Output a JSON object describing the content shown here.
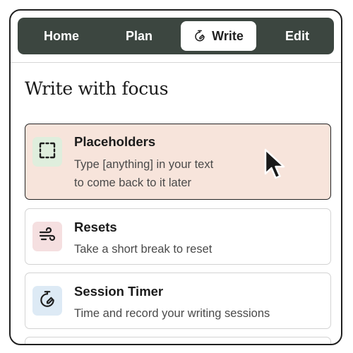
{
  "nav": {
    "tabs": [
      {
        "label": "Home"
      },
      {
        "label": "Plan"
      },
      {
        "label": "Write",
        "icon": "timer-pen-icon",
        "active": true
      },
      {
        "label": "Edit"
      }
    ]
  },
  "page": {
    "title": "Write with focus"
  },
  "cards": [
    {
      "title": "Placeholders",
      "desc_line1": "Type [anything] in your text",
      "desc_line2": "to come back to it later",
      "icon": "placeholder-dashed-box-icon",
      "badge_color": "#dfeedd",
      "active": true
    },
    {
      "title": "Resets",
      "desc": "Take a short break to reset",
      "icon": "wind-icon",
      "badge_color": "#f5dfe0"
    },
    {
      "title": "Session Timer",
      "desc": "Time and record your writing sessions",
      "icon": "timer-pen-icon",
      "badge_color": "#ddeaf5"
    }
  ],
  "colors": {
    "nav_bg": "#3c4640",
    "active_card_bg": "#f7e4db",
    "border": "#d3d3d3"
  }
}
